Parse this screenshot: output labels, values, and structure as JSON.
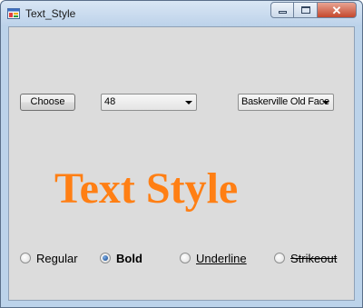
{
  "window": {
    "title": "Text_Style",
    "minimize_glyph": "",
    "maximize_glyph": "",
    "close_glyph": "✕"
  },
  "controls": {
    "choose_button_label": "Choose",
    "size_combo_value": "48",
    "font_combo_value": "Baskerville Old Face"
  },
  "preview": {
    "text": "Text Style",
    "color": "#ff7f14"
  },
  "styles": {
    "regular_label": "Regular",
    "bold_label": "Bold",
    "underline_label": "Underline",
    "strikeout_label": "Strikeout",
    "selected": "Bold"
  }
}
